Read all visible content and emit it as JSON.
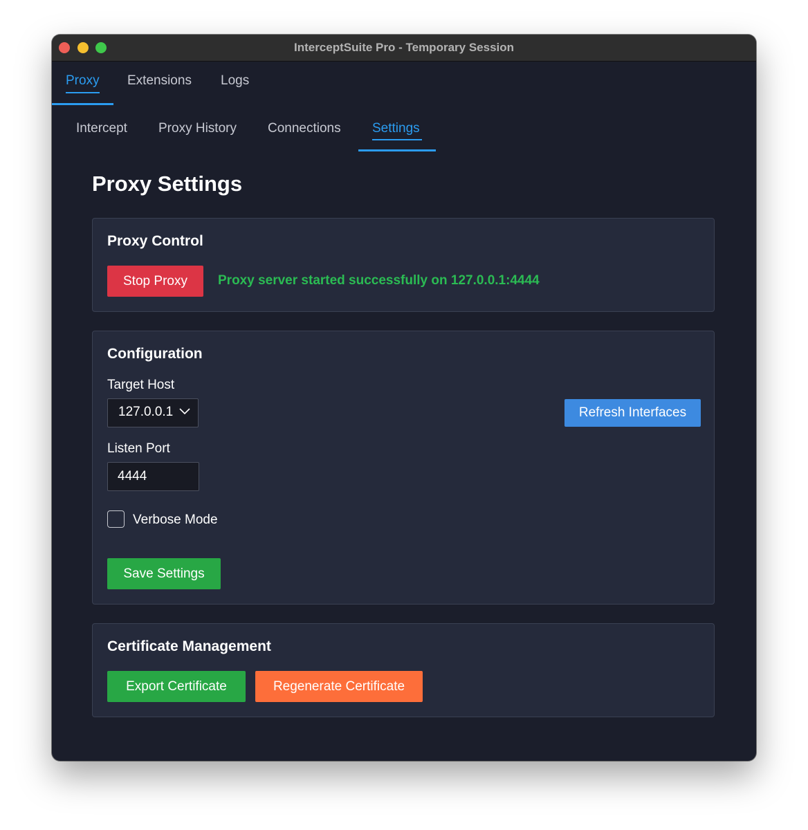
{
  "window": {
    "title": "InterceptSuite Pro - Temporary Session"
  },
  "top_tabs": [
    {
      "label": "Proxy",
      "active": true
    },
    {
      "label": "Extensions",
      "active": false
    },
    {
      "label": "Logs",
      "active": false
    }
  ],
  "sub_tabs": [
    {
      "label": "Intercept",
      "active": false
    },
    {
      "label": "Proxy History",
      "active": false
    },
    {
      "label": "Connections",
      "active": false
    },
    {
      "label": "Settings",
      "active": true
    }
  ],
  "page": {
    "title": "Proxy Settings"
  },
  "proxy_control": {
    "title": "Proxy Control",
    "stop_button": "Stop Proxy",
    "status": "Proxy server started successfully on 127.0.0.1:4444"
  },
  "configuration": {
    "title": "Configuration",
    "target_host_label": "Target Host",
    "target_host_value": "127.0.0.1",
    "refresh_button": "Refresh Interfaces",
    "listen_port_label": "Listen Port",
    "listen_port_value": "4444",
    "verbose_label": "Verbose Mode",
    "verbose_checked": false,
    "save_button": "Save Settings"
  },
  "certificate": {
    "title": "Certificate Management",
    "export_button": "Export Certificate",
    "regenerate_button": "Regenerate Certificate"
  },
  "colors": {
    "accent": "#2b9cf0",
    "danger": "#dc3545",
    "success": "#28a745",
    "info": "#3d8ae0",
    "warning": "#fd6e3a",
    "status_text": "#2bbb53"
  }
}
